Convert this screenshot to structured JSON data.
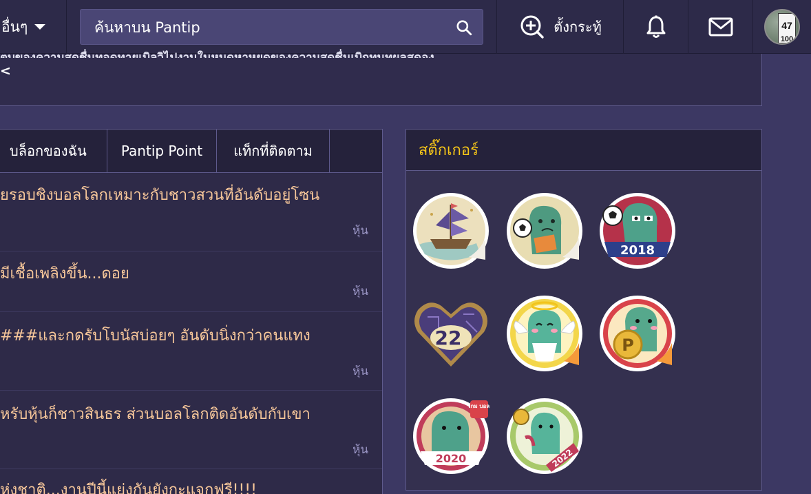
{
  "topbar": {
    "more_label": "อื่นๆ",
    "search_placeholder": "ค้นหาบน Pantip",
    "create_topic_label": "ตั้งกระทู้",
    "avatar_sign": {
      "line1": "47",
      "line2": "100"
    }
  },
  "top_panel": {
    "cut_text": "ตบของความสดชื่นทอดทายเบิลวิไปงานในหมดหาหยดของความสดชื่นเบิกทนทผลสดอง",
    "back_label": "<"
  },
  "tabs": [
    {
      "label": "บล็อกของฉัน"
    },
    {
      "label": "Pantip Point"
    },
    {
      "label": "แท็กที่ติดตาม"
    }
  ],
  "feed": [
    {
      "title": "ยรอบชิงบอลโลกเหมาะกับชาวสวนที่อันดับอยู่โซน",
      "tag": "หุ้น"
    },
    {
      "title": "มีเชื้อเพลิงขึ้น...ดอย",
      "tag": "หุ้น"
    },
    {
      "title": "###และกดรับโบนัสบ่อยๆ อันดับนิ่งกว่าคนแทง",
      "tag": "หุ้น"
    },
    {
      "title": "หรับหุ้นก็ชาวสินธร ส่วนบอลโลกติดอันดับกับเขา",
      "tag": "หุ้น"
    },
    {
      "title": "ห่งชาติ...งานปีนี้แย่งกันยังกะแจกฟรี!!!!"
    }
  ],
  "sticker_panel": {
    "title": "สติ๊กเกอร์",
    "stickers": [
      {
        "name": "ship"
      },
      {
        "name": "football-2014"
      },
      {
        "name": "worldcup-2018",
        "text": "2018"
      },
      {
        "name": "heart-22",
        "text": "22"
      },
      {
        "name": "angel"
      },
      {
        "name": "pantip-point",
        "text": "P"
      },
      {
        "name": "game-ball-2020",
        "text": "2020",
        "badge": "เกม บอล"
      },
      {
        "name": "worldcup-2022",
        "text": "2022"
      }
    ]
  },
  "colors": {
    "background": "#3c3863",
    "topbar": "#2d2a49",
    "title_text": "#f7c79a",
    "tag_text": "#9d98c8",
    "sticker_header": "#f5c518"
  }
}
